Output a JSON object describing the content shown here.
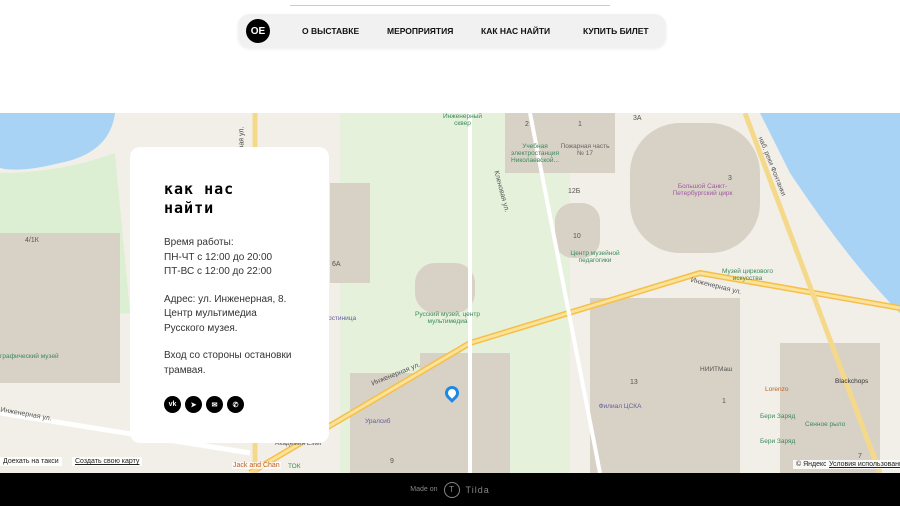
{
  "nav": {
    "logo": "OE",
    "items": [
      "О ВЫСТАВКЕ",
      "МЕРОПРИЯТИЯ",
      "КАК НАС НАЙТИ",
      "КУПИТЬ БИЛЕТ"
    ]
  },
  "card": {
    "title": "как нас найти",
    "hours_label": "Время работы:",
    "hours_1": "ПН-ЧТ с 12:00 до 20:00",
    "hours_2": "ПТ-ВС с 12:00 до 22:00",
    "address_1": "Адрес: ул. Инженерная, 8.",
    "address_2": "Центр мультимедиа",
    "address_3": "Русского музея.",
    "entry_1": "Вход со стороны остановки",
    "entry_2": "трамвая.",
    "social": [
      "vk",
      "telegram",
      "email",
      "phone"
    ]
  },
  "map": {
    "taxi": "Доехать на такси",
    "create": "Создать свою карту",
    "copyright": "© Яндекс",
    "terms": "Условия использования",
    "labels": {
      "museum": "Русский музей, центр мультимедиа",
      "power": "Учебная электростанция Николаевской...",
      "fire": "Пожарная часть № 17",
      "circus": "Большой Санкт-Петербургский цирк",
      "pedagogy": "Центр музейной педагогики",
      "circus_museum": "Музей циркового искусства",
      "square": "Инженерный сквер",
      "cska": "Филиал ЦСКА",
      "niitmash": "НИИТМаш",
      "lorenzo": "Lorenzo",
      "blackchops": "Blackchops",
      "beri1": "Бери Заряд",
      "beri2": "Бери Заряд",
      "syrnoe": "Сенное рыло",
      "uralsib": "Уралсиб",
      "estel": "Академия Estel",
      "jack": "Jack and Chan",
      "tok": "ТОК",
      "graphic": "графический музей",
      "hotel": "Гостиница"
    },
    "streets": {
      "eng1": "Инженерная ул.",
      "eng2": "Инженерная ул.",
      "eng3": "Инженерная ул.",
      "fontanka": "наб. реки Фонтанки",
      "sadovaya": "Садовая ул.",
      "klenovaya": "Кленовая ул."
    },
    "numbers": [
      "2",
      "1",
      "3А",
      "12Б",
      "10",
      "3",
      "6А",
      "4/1К",
      "13",
      "1",
      "9",
      "7"
    ]
  },
  "footer": {
    "made_on": "Made on",
    "tilda": "Tilda"
  }
}
